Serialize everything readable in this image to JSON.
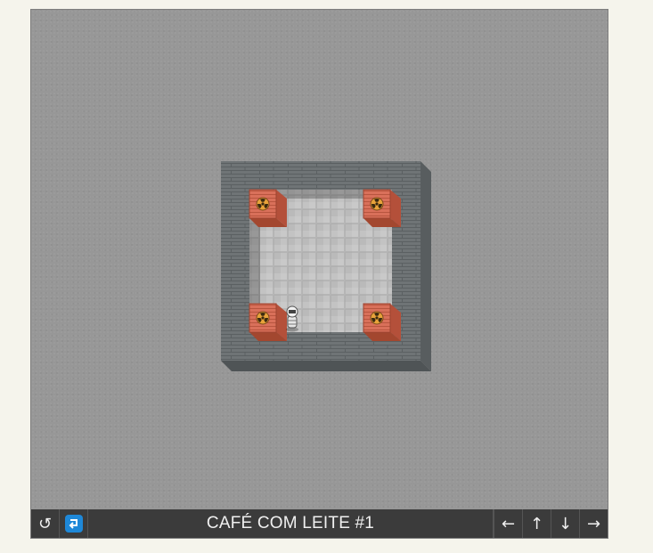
{
  "level": {
    "title": "CAFÉ COM LEITE #1"
  },
  "toolbar": {
    "undo_icon": "↺",
    "redo_icon": "redo-arrow-icon",
    "arrow_left": "←",
    "arrow_up": "↑",
    "arrow_down": "↓",
    "arrow_right": "→"
  },
  "board": {
    "grid": [
      "#######",
      "#*   *#",
      "#     #",
      "#     #",
      "#     #",
      "#*@  *#",
      "#######"
    ],
    "legend": {
      "#": "wall",
      "*": "crate-on-goal",
      "@": "player",
      " ": "floor"
    }
  },
  "colors": {
    "background": "#979797",
    "wall": "#6f7476",
    "floor": "#bdbdbd",
    "crate": "#d9705a",
    "hazard": "#e8a33a",
    "toolbar": "#3b3b3b",
    "redo_badge": "#1e88d8"
  }
}
